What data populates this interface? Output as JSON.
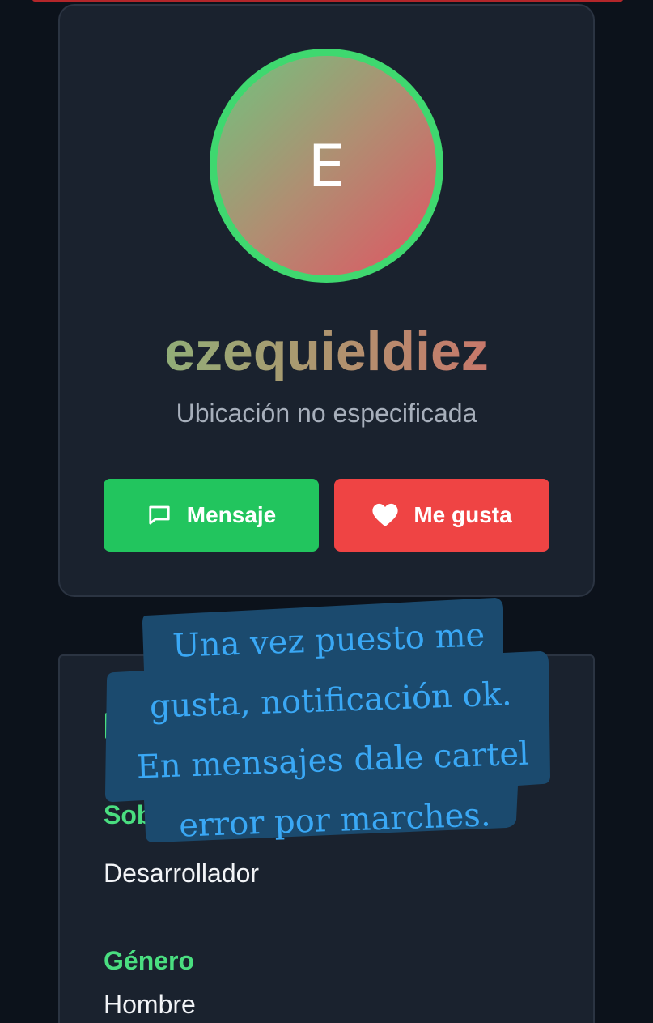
{
  "profile": {
    "avatar_initial": "E",
    "username": "ezequieldiez",
    "location": "Ubicación no especificada"
  },
  "actions": {
    "message_label": "Mensaje",
    "like_label": "Me gusta"
  },
  "details": {
    "about_label": "Sob",
    "about_value": "Desarrollador",
    "gender_label": "Género",
    "gender_value": "Hombre"
  },
  "annotation": {
    "lines": [
      "Una vez puesto me",
      "gusta, notificación ok.",
      "En mensajes dale cartel",
      "error por marches."
    ]
  },
  "icons": {
    "message": "message-square-icon",
    "like": "heart-icon"
  },
  "colors": {
    "background": "#0c121b",
    "card": "#1a222e",
    "accent_green": "#22c55e",
    "accent_red": "#ef4444",
    "label_green": "#4ade80",
    "note_bg": "#1b4a6e",
    "note_text": "#3aa8f5"
  }
}
